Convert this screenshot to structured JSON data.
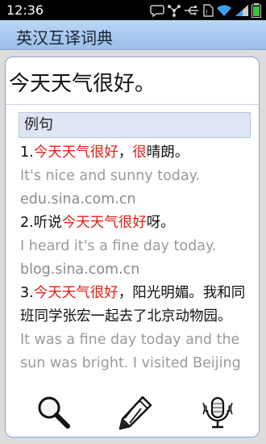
{
  "status_bar": {
    "time": "12:36"
  },
  "app_bar": {
    "title": "英汉互译词典"
  },
  "query": {
    "text": "今天天气很好。"
  },
  "examples": {
    "header": "例句",
    "items": [
      {
        "num": "1.",
        "zh_parts": [
          {
            "text": "今天天气很好",
            "highlight": true
          },
          {
            "text": "，",
            "highlight": false
          },
          {
            "text": "很",
            "highlight": true
          },
          {
            "text": "晴朗。",
            "highlight": false
          }
        ],
        "en": "It's nice and sunny today.",
        "source": "edu.sina.com.cn"
      },
      {
        "num": "2.",
        "zh_parts": [
          {
            "text": "听说",
            "highlight": false
          },
          {
            "text": "今天天气很好",
            "highlight": true
          },
          {
            "text": "呀。",
            "highlight": false
          }
        ],
        "en": "I heard it's a fine day today.",
        "source": "blog.sina.com.cn"
      },
      {
        "num": "3.",
        "zh_parts": [
          {
            "text": "今天天气很好",
            "highlight": true
          },
          {
            "text": "，阳光明媚。我和同班同学张宏一起去了北京动物园。",
            "highlight": false
          }
        ],
        "en": "It was a fine day today and the sun was bright. I visited Beijing",
        "source": ""
      }
    ]
  },
  "toolbar": {
    "buttons": [
      {
        "icon": "magnifier-icon"
      },
      {
        "icon": "pencil-icon"
      },
      {
        "icon": "microphone-icon"
      }
    ]
  },
  "colors": {
    "highlight": "#e0201a",
    "accent": "#a6c7ee",
    "border": "#7fa6d8"
  }
}
